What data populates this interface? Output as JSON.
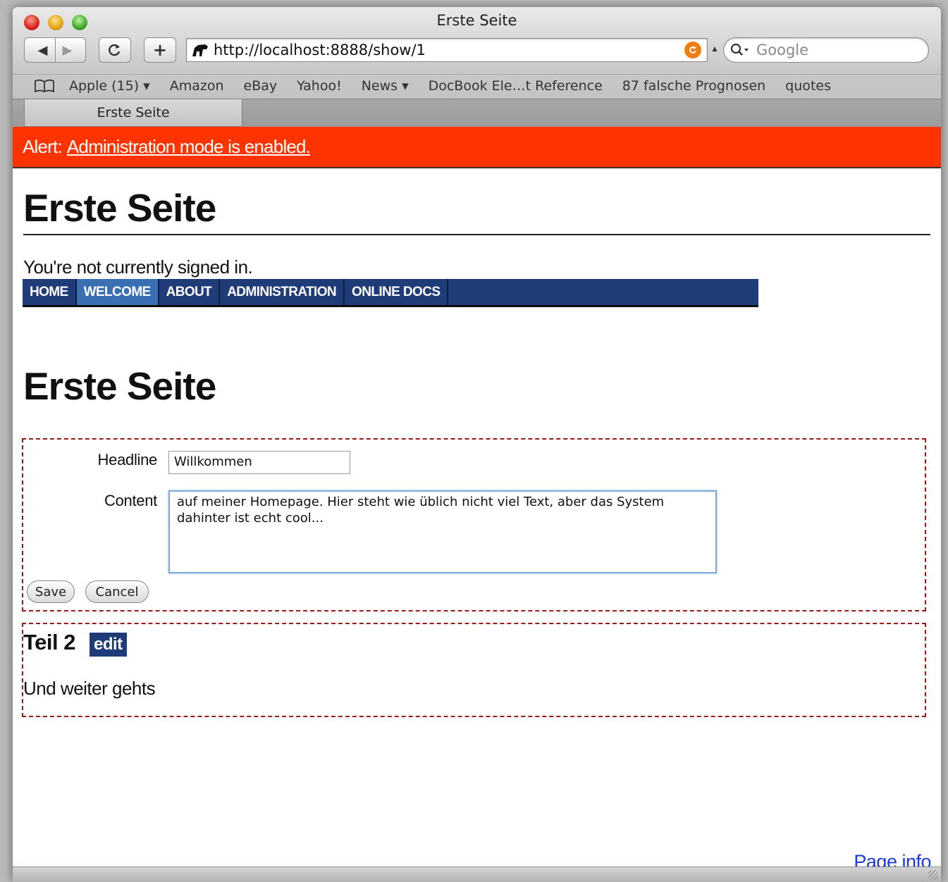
{
  "window": {
    "title": "Erste Seite"
  },
  "toolbar": {
    "back_icon": "back-arrow",
    "forward_icon": "forward-arrow",
    "reload_icon": "reload",
    "add_icon": "plus",
    "url": "http://localhost:8888/show/1",
    "search_placeholder": "Google"
  },
  "bookmarks": [
    "Apple (15) ▾",
    "Amazon",
    "eBay",
    "Yahoo!",
    "News ▾",
    "DocBook Ele…t Reference",
    "87 falsche Prognosen",
    "quotes"
  ],
  "tab": {
    "label": "Erste Seite"
  },
  "alert": {
    "prefix": "Alert:",
    "link": "Administration mode is enabled.",
    "color": "#ff3300"
  },
  "site": {
    "title": "Erste Seite",
    "signin_status": "You're not currently signed in."
  },
  "nav": {
    "items": [
      "HOME",
      "WELCOME",
      "ABOUT",
      "ADMINISTRATION",
      "ONLINE DOCS"
    ],
    "active": "WELCOME",
    "color": "#1f3b78",
    "active_color": "#3b6fb3"
  },
  "page": {
    "title": "Erste Seite"
  },
  "form": {
    "headline_label": "Headline",
    "headline_value": "Willkommen",
    "content_label": "Content",
    "content_value": "auf meiner Homepage. Hier steht wie üblich nicht viel Text, aber das System dahinter ist echt cool...",
    "save_label": "Save",
    "cancel_label": "Cancel"
  },
  "part2": {
    "title": "Teil 2",
    "edit_label": "edit",
    "text": "Und weiter gehts"
  },
  "footer": {
    "page_info": "Page info"
  }
}
